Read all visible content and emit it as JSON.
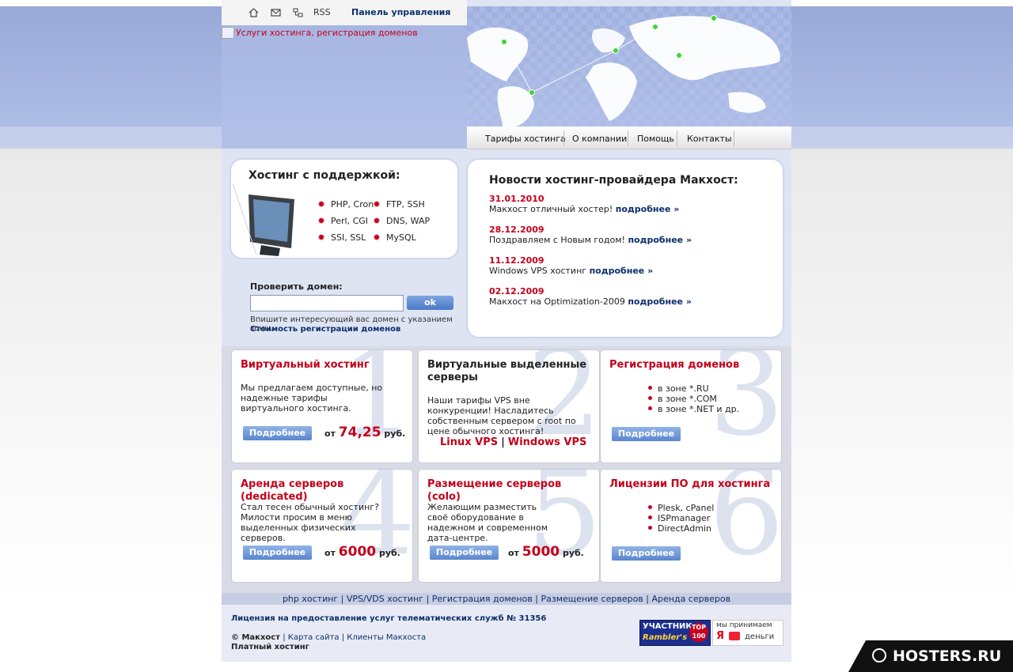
{
  "header": {
    "rss": "RSS",
    "panel": "Панель управления",
    "logo_alt": "Услуги хостинга, регистрация доменов",
    "nav": [
      "Тарифы хостинга",
      "О компании",
      "Помощь",
      "Контакты"
    ]
  },
  "hosting": {
    "title": "Хостинг с поддержкой:",
    "features": [
      "PHP, Cron",
      "FTP, SSH",
      "Perl, CGI",
      "DNS, WAP",
      "SSI, SSL",
      "MySQL"
    ]
  },
  "domain_check": {
    "label": "Проверить домен:",
    "input_value": "",
    "button": "ok",
    "hint": "Впишите интересующий вас домен с указанием зоны.",
    "price_link": "Стоимость регистрации доменов"
  },
  "news": {
    "title": "Новости хостинг-провайдера Макхост:",
    "more": "подробнее »",
    "items": [
      {
        "date": "31.01.2010",
        "text": "Макхост отличный хостер!"
      },
      {
        "date": "28.12.2009",
        "text": "Поздравляем с Новым годом!"
      },
      {
        "date": "11.12.2009",
        "text": "Windows VPS хостинг"
      },
      {
        "date": "02.12.2009",
        "text": "Макхост на Optimization-2009"
      }
    ]
  },
  "cards": {
    "more": "Подробнее",
    "from": "от",
    "currency": "руб.",
    "c1": {
      "num": "1",
      "title": "Виртуальный хостинг",
      "text": "Мы предлагаем доступные, но надежные тарифы виртуального хостинга.",
      "price": "74,25"
    },
    "c2": {
      "num": "2",
      "title": "Виртуальные выделенные серверы",
      "text": "Наши тарифы VPS вне конкуренции! Насладитесь собственным сервером с root по цене обычного хостинга!",
      "linux": "Linux VPS",
      "sep": "|",
      "windows": "Windows VPS"
    },
    "c3": {
      "num": "3",
      "title": "Регистрация доменов",
      "items": [
        "в зоне *.RU",
        "в зоне *.COM",
        "в зоне *.NET и др."
      ]
    },
    "c4": {
      "num": "4",
      "title": "Аренда серверов (dedicated)",
      "text": "Стал тесен обычный хостинг? Милости просим в меню выделенных физических серверов.",
      "price": "6000"
    },
    "c5": {
      "num": "5",
      "title": "Размещение серверов (colo)",
      "text": "Желающим разместить своё оборудование в надежном и современном дата-центре.",
      "price": "5000"
    },
    "c6": {
      "num": "6",
      "title": "Лицензии ПО для хостинга",
      "items": [
        "Plesk, cPanel",
        "ISPmanager",
        "DirectAdmin"
      ]
    }
  },
  "footer": {
    "links": [
      "php хостинг",
      "VPS/VDS хостинг",
      "Регистрация доменов",
      "Размещение серверов",
      "Аренда серверов"
    ],
    "license": "Лицензия на предоставление услуг телематических служб № 31356",
    "copyright": "© Макхост",
    "sitemap": "Карта сайта",
    "clients": "Клиенты Макхоста",
    "paid": "Платный хостинг",
    "rambler_l1": "УЧАСТНИК",
    "rambler_l2": "Rambler's",
    "rambler_top": "TOP 100",
    "yad_a": "мы принимаем",
    "yad_ya": "Я",
    "yad_b": "деньги"
  },
  "watermark": "HOSTERS.RU"
}
